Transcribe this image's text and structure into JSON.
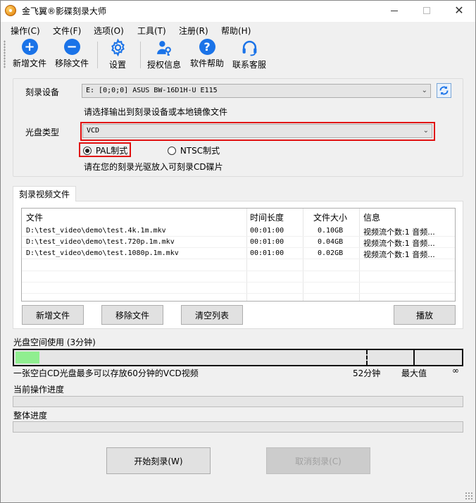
{
  "window": {
    "title": "金飞翼®影碟刻录大师",
    "controls": {
      "minimize": "—",
      "close": "✕"
    }
  },
  "menu": [
    "操作(C)",
    "文件(F)",
    "选项(O)",
    "工具(T)",
    "注册(R)",
    "帮助(H)"
  ],
  "toolbar": {
    "add_file": "新增文件",
    "remove_file": "移除文件",
    "settings": "设置",
    "license": "授权信息",
    "help": "软件帮助",
    "support": "联系客服",
    "icons": [
      "plus-circle-icon",
      "minus-circle-icon",
      "gear-icon",
      "key-user-icon",
      "question-circle-icon",
      "headset-icon"
    ]
  },
  "device": {
    "label": "刻录设备",
    "value": "E:  [0;0;0] ASUS BW-16D1H-U E115",
    "hint": "请选择输出到刻录设备或本地镜像文件"
  },
  "disc": {
    "label": "光盘类型",
    "value": "VCD",
    "pal": "PAL制式",
    "ntsc": "NTSC制式",
    "selected": "PAL制式",
    "hint": "请在您的刻录光驱放入可刻录CD碟片"
  },
  "tab": {
    "label": "刻录视频文件"
  },
  "file_list": {
    "columns": [
      "文件",
      "时间长度",
      "文件大小",
      "信息"
    ],
    "rows": [
      [
        "D:\\test_video\\demo\\test.4k.1m.mkv",
        "00:01:00",
        "0.10GB",
        "视频流个数:1 音频..."
      ],
      [
        "D:\\test_video\\demo\\test.720p.1m.mkv",
        "00:01:00",
        "0.04GB",
        "视频流个数:1 音频..."
      ],
      [
        "D:\\test_video\\demo\\test.1080p.1m.mkv",
        "00:01:00",
        "0.02GB",
        "视频流个数:1 音频..."
      ]
    ]
  },
  "list_buttons": {
    "add": "新增文件",
    "remove": "移除文件",
    "clear": "清空列表",
    "play": "播放"
  },
  "disk_usage": {
    "label": "光盘空间使用 (3分钟)",
    "used_minutes": 3,
    "note": "一张空白CD光盘最多可以存放60分钟的VCD视频",
    "mark_52": "52分钟",
    "mark_max": "最大值",
    "mark_inf": "∞"
  },
  "progress": {
    "current_label": "当前操作进度",
    "current_value": 0,
    "overall_label": "整体进度",
    "overall_value": 0
  },
  "actions": {
    "start": "开始刻录(W)",
    "cancel": "取消刻录(C)"
  },
  "colors": {
    "accent": "#1a73e8",
    "highlight": "#e01010",
    "disk_fill": "#90ee90"
  }
}
